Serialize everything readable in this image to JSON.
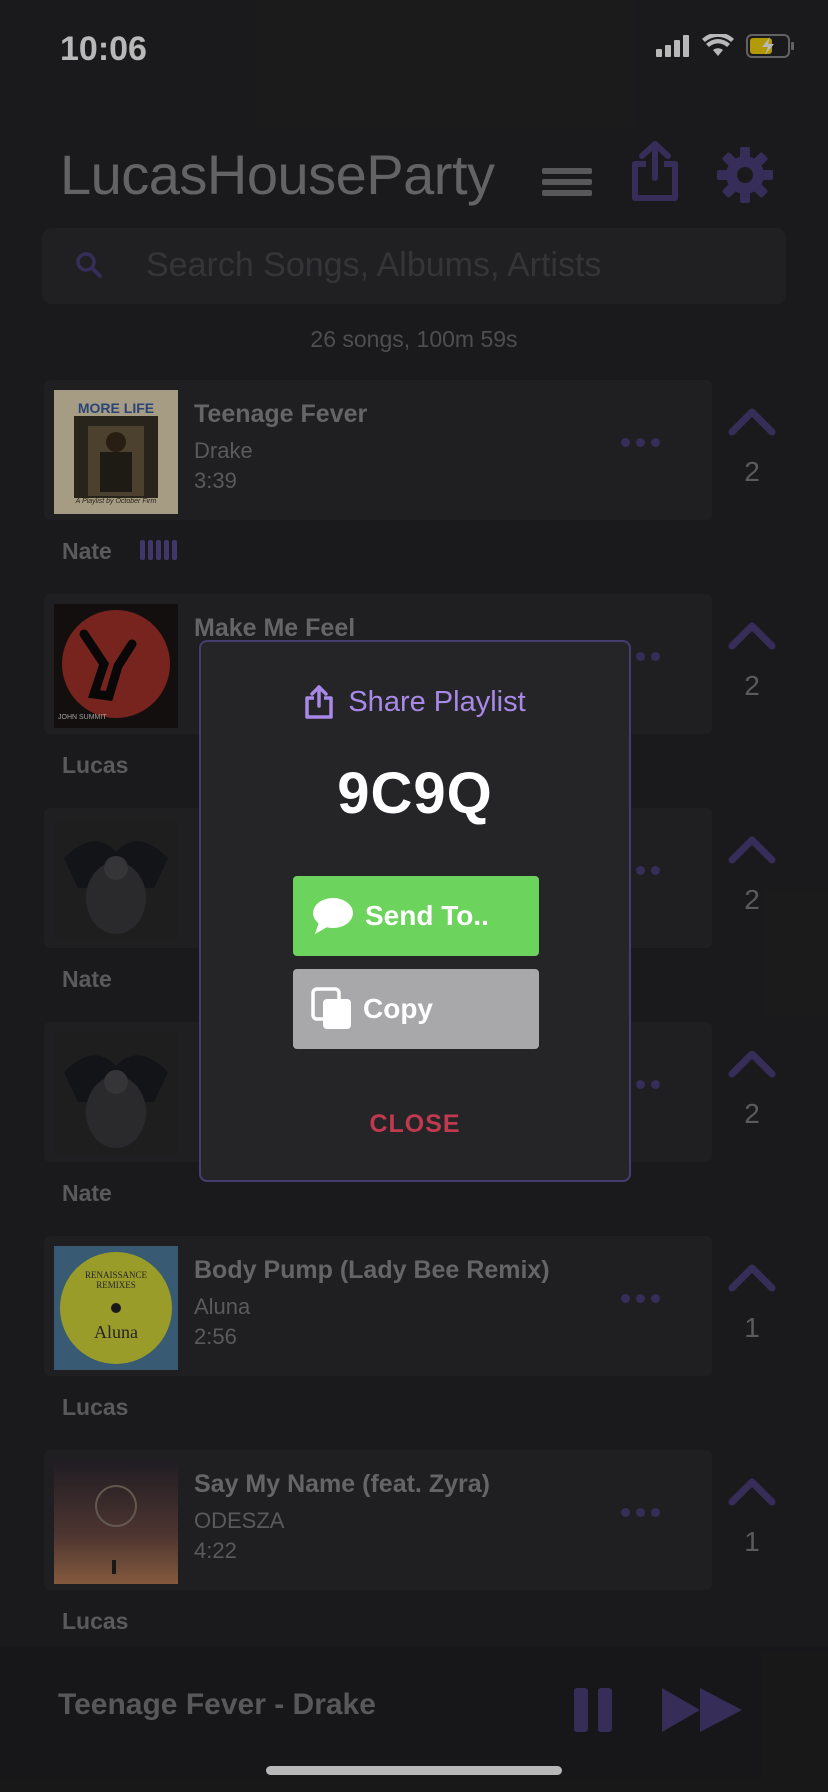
{
  "status": {
    "time": "10:06"
  },
  "header": {
    "title": "LucasHouseParty"
  },
  "search": {
    "placeholder": "Search Songs, Albums, Artists"
  },
  "summary": "26 songs, 100m 59s",
  "songs": [
    {
      "title": "Teenage Fever",
      "artist": "Drake",
      "duration": "3:39",
      "votes": "2",
      "added_by": "Nate",
      "playing": true
    },
    {
      "title": "Make Me Feel",
      "artist": "",
      "duration": "",
      "votes": "2",
      "added_by": "Lucas"
    },
    {
      "title": "",
      "artist": "",
      "duration": "",
      "votes": "2",
      "added_by": "Nate"
    },
    {
      "title": "",
      "artist": "",
      "duration": "",
      "votes": "2",
      "added_by": "Nate"
    },
    {
      "title": "Body Pump (Lady Bee Remix)",
      "artist": "Aluna",
      "duration": "2:56",
      "votes": "1",
      "added_by": "Lucas"
    },
    {
      "title": "Say My Name (feat. Zyra)",
      "artist": "ODESZA",
      "duration": "4:22",
      "votes": "1",
      "added_by": "Lucas"
    }
  ],
  "album_art_text": {
    "more_life": "MORE LIFE",
    "more_life_sub": "A Playlist by October Firm",
    "john_summit": "JOHN SUMMIT",
    "renaissance": "RENAISSANCE REMIXES",
    "aluna": "Aluna"
  },
  "modal": {
    "title": "Share Playlist",
    "code": "9C9Q",
    "send_label": "Send To..",
    "copy_label": "Copy",
    "close_label": "CLOSE"
  },
  "player": {
    "now_playing": "Teenage Fever - Drake"
  },
  "colors": {
    "accent": "#a889e8",
    "send": "#6cd35c",
    "copy": "#a8a8aa",
    "close": "#c1394f",
    "icon_purple": "#4c3f7a"
  }
}
